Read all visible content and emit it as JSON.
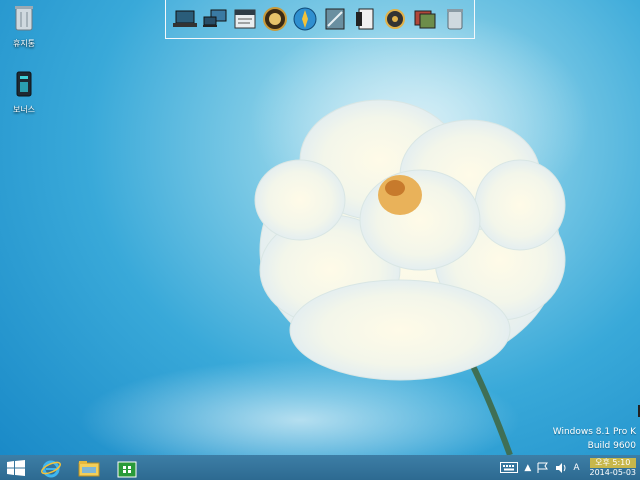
{
  "desktop": {
    "icons": [
      {
        "label": "휴지통",
        "icon": "recycle-bin-icon"
      },
      {
        "label": "보너스",
        "icon": "server-tower-icon"
      }
    ]
  },
  "dock": {
    "items": [
      "laptop-icon",
      "monitor-laptop-icon",
      "notepad-icon",
      "clock-face-icon",
      "globe-compass-icon",
      "ruler-edit-icon",
      "document-icon",
      "gear-star-icon",
      "photo-stack-icon",
      "trash-can-icon"
    ]
  },
  "watermark": {
    "line1": "Windows 8.1 Pro K",
    "line2": "Build 9600"
  },
  "taskbar": {
    "start": "windows-start-icon",
    "pinned": [
      "internet-explorer-icon",
      "file-explorer-icon",
      "store-icon"
    ],
    "tray": {
      "keyboard": "keyboard-icon",
      "chevron": "▲",
      "lang": "A",
      "time": "오후 5:10",
      "date": "2014-05-03"
    }
  }
}
